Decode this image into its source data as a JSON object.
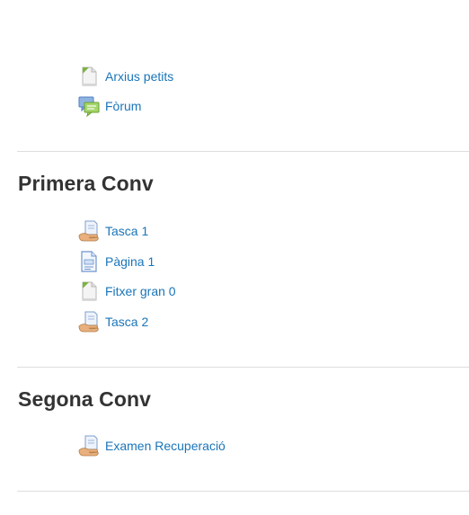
{
  "colors": {
    "link": "#1a75b8",
    "heading": "#333333",
    "divider": "#dddddd",
    "background": "#ffffff"
  },
  "section0": {
    "activities": [
      {
        "label": "Arxius petits",
        "icon": "file-icon"
      },
      {
        "label": "Fòrum",
        "icon": "forum-icon"
      }
    ]
  },
  "section1": {
    "title": "Primera Conv",
    "activities": [
      {
        "label": "Tasca 1",
        "icon": "assignment-icon"
      },
      {
        "label": "Pàgina 1",
        "icon": "page-icon"
      },
      {
        "label": "Fitxer gran 0",
        "icon": "file-icon"
      },
      {
        "label": "Tasca 2",
        "icon": "assignment-icon"
      }
    ]
  },
  "section2": {
    "title": "Segona Conv",
    "activities": [
      {
        "label": "Examen Recuperació",
        "icon": "assignment-icon"
      }
    ]
  }
}
